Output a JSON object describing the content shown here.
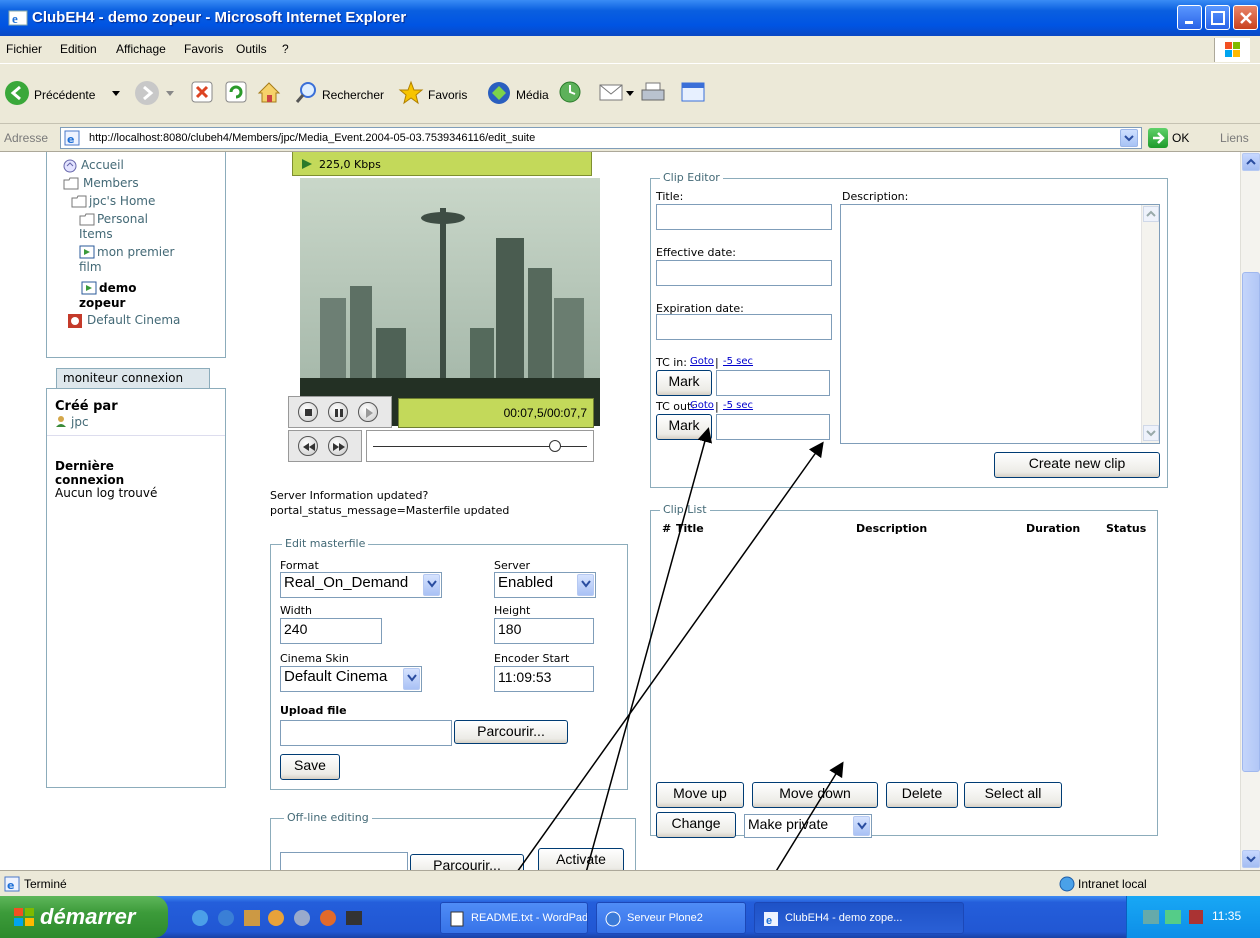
{
  "window": {
    "title": "ClubEH4 - demo zopeur - Microsoft Internet Explorer"
  },
  "menu": [
    "Fichier",
    "Edition",
    "Affichage",
    "Favoris",
    "Outils",
    "?"
  ],
  "toolbar": {
    "back_label": "Précédente",
    "search_label": "Rechercher",
    "favorites_label": "Favoris",
    "media_label": "Média"
  },
  "address": {
    "label": "Adresse",
    "url": "http://localhost:8080/clubeh4/Members/jpc/Media_Event.2004-05-03.7539346116/edit_suite",
    "go_label": "OK",
    "links_label": "Liens"
  },
  "nav": {
    "items": [
      "Accueil",
      "Members",
      "jpc's Home",
      "Personal",
      "Items",
      "mon premier",
      "film",
      "demo",
      "zopeur",
      "Default Cinema"
    ]
  },
  "monitor": {
    "tab_label": "moniteur connexion",
    "created_by_label": "Créé par",
    "created_by_value": "jpc",
    "last_login_label_1": "Dernière",
    "last_login_label_2": "connexion",
    "last_login_value": "Aucun log trouvé"
  },
  "player": {
    "bitrate": "225,0 Kbps",
    "timecode": "00:07,5/00:07,7",
    "position_fraction": 0.85
  },
  "status_message": {
    "line1": "Server Information updated?",
    "line2": "portal_status_message=Masterfile updated"
  },
  "edit_masterfile": {
    "legend": "Edit masterfile",
    "format_label": "Format",
    "format_value": "Real_On_Demand",
    "server_label": "Server",
    "server_value": "Enabled",
    "width_label": "Width",
    "width_value": "240",
    "height_label": "Height",
    "height_value": "180",
    "skin_label": "Cinema Skin",
    "skin_value": "Default Cinema",
    "encoder_label": "Encoder Start",
    "encoder_value": "11:09:53",
    "upload_label": "Upload file",
    "browse_label": "Parcourir...",
    "save_label": "Save"
  },
  "offline": {
    "legend": "Off-line editing",
    "browse_label": "Parcourir...",
    "activate_label": "Activate"
  },
  "clip_editor": {
    "legend": "Clip Editor",
    "title_label": "Title:",
    "description_label": "Description:",
    "effective_label": "Effective date:",
    "expiration_label": "Expiration date:",
    "tc_in_label": "TC in:",
    "tc_out_label": "TC out:",
    "goto_label": "Goto",
    "minus5_label": "-5 sec",
    "separator": "|",
    "mark_label": "Mark",
    "create_label": "Create new clip"
  },
  "clip_list": {
    "legend": "Clip List",
    "columns": [
      "#",
      "Title",
      "Description",
      "Duration",
      "Status"
    ],
    "move_up_label": "Move up",
    "move_down_label": "Move down",
    "delete_label": "Delete",
    "select_all_label": "Select all",
    "change_label": "Change",
    "private_value": "Make private"
  },
  "statusbar": {
    "status": "Terminé",
    "zone": "Intranet local"
  },
  "taskbar": {
    "start_label": "démarrer",
    "tasks": [
      "README.txt - WordPad",
      "Serveur Plone2",
      "ClubEH4 - demo zope..."
    ],
    "clock": "11:35"
  }
}
